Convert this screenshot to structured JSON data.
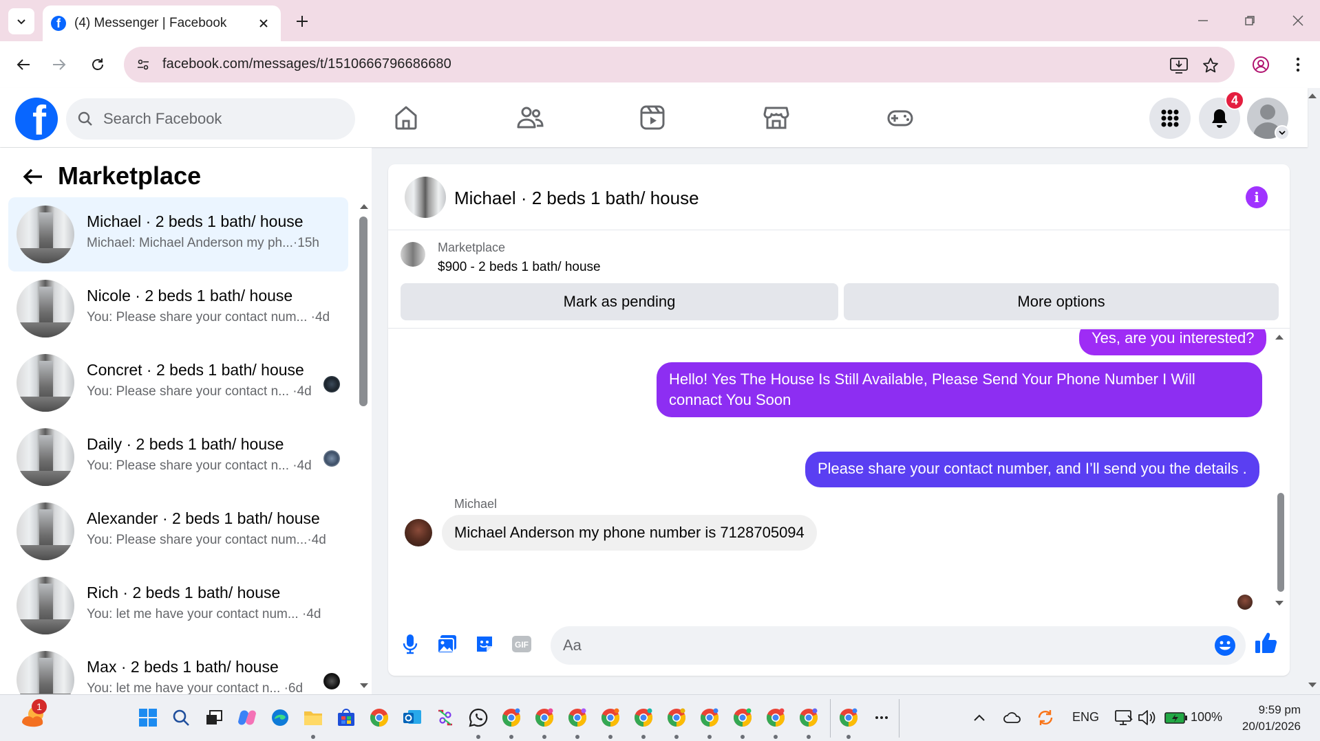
{
  "browser": {
    "tab_title": "(4) Messenger | Facebook",
    "url_domain": "facebook.com",
    "url_path": "/messages/t/1510666796686680"
  },
  "fb": {
    "search_placeholder": "Search Facebook",
    "notification_count": "4",
    "brand_color": "#0866ff"
  },
  "sidebar": {
    "title": "Marketplace",
    "conversations": [
      {
        "name": "Michael · 2 beds 1 bath/ house",
        "snippet": "Michael: Michael Anderson my ph...",
        "time": "15h",
        "active": true
      },
      {
        "name": "Nicole · 2 beds 1 bath/ house",
        "snippet": "You: Please share your contact num...",
        "time": "4d"
      },
      {
        "name": "Concret · 2 beds 1 bath/ house",
        "snippet": "You: Please share your contact n...",
        "time": "4d"
      },
      {
        "name": "Daily · 2 beds 1 bath/ house",
        "snippet": "You: Please share your contact n...",
        "time": "4d"
      },
      {
        "name": "Alexander · 2 beds 1 bath/ house",
        "snippet": "You: Please share your contact num...",
        "time": "4d"
      },
      {
        "name": "Rich · 2 beds 1 bath/ house",
        "snippet": "You: let me have your contact num...",
        "time": "4d"
      },
      {
        "name": "Max · 2 beds 1 bath/ house",
        "snippet": "You: let me have your contact n...",
        "time": "6d"
      }
    ]
  },
  "chat": {
    "title": "Michael · 2 beds 1 bath/ house",
    "marketplace_label": "Marketplace",
    "listing": "$900 - 2 beds 1 bath/ house",
    "mark_pending": "Mark as pending",
    "more_options": "More options",
    "messages_out": [
      "Yes, are you interested?",
      "Hello! Yes The House  Is Still Available, Please Send Your Phone Number I Will connact You Soon",
      "Please share your contact number, and I’ll send you the details ."
    ],
    "incoming_sender": "Michael",
    "incoming_text": "Michael Anderson my phone number is 7128705094",
    "composer_placeholder": "Aa",
    "accent_color": "#a033ff"
  },
  "taskbar": {
    "weather_badge": "1",
    "lang": "ENG",
    "battery": "100%",
    "time": "9:59 pm",
    "date": "20/01/2026"
  }
}
